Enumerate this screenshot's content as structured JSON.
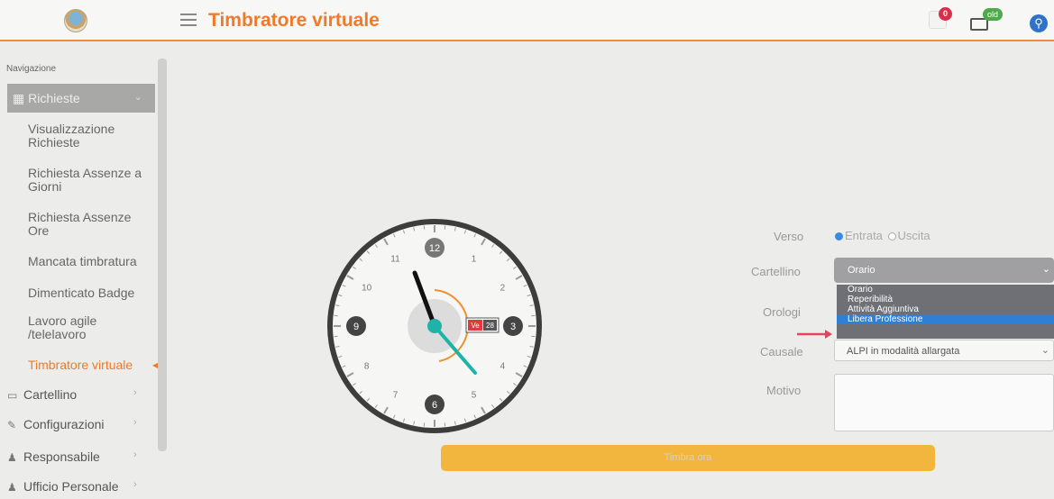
{
  "header": {
    "title": "Timbratore virtuale",
    "notifications_count": "0",
    "mail_badge": "old",
    "accessibility_glyph": "⚲",
    "accent_color": "#ef7a2a"
  },
  "sidebar": {
    "nav_title": "Navigazione",
    "active_group": "Richieste",
    "items": [
      {
        "label": "Visualizzazione Richieste"
      },
      {
        "label": "Richiesta Assenze a Giorni"
      },
      {
        "label": "Richiesta Assenze Ore"
      },
      {
        "label": "Mancata timbratura"
      },
      {
        "label": "Dimenticato Badge"
      },
      {
        "label": "Lavoro agile /telelavoro"
      },
      {
        "label": "Timbratore virtuale"
      }
    ],
    "groups": [
      {
        "label": "Cartellino",
        "icon": "calendar-icon"
      },
      {
        "label": "Configurazioni",
        "icon": "wrench-icon"
      },
      {
        "label": "Responsabile",
        "icon": "user-icon"
      },
      {
        "label": "Ufficio Personale",
        "icon": "users-icon"
      }
    ]
  },
  "clock": {
    "numerals": [
      "12",
      "1",
      "2",
      "3",
      "4",
      "5",
      "6",
      "7",
      "8",
      "9",
      "10",
      "11"
    ],
    "date_day": "Ve",
    "date_num": "28"
  },
  "form": {
    "verso_label": "Verso",
    "verso_options": [
      "Entrata",
      "Uscita"
    ],
    "verso_selected": "Entrata",
    "cartellino_label": "Cartellino",
    "cartellino_value": "Orario",
    "cartellino_options": [
      "Orario",
      "Reperibilità",
      "Attività Aggiuntiva",
      "Libera Professione"
    ],
    "cartellino_highlighted": "Libera Professione",
    "orologi_label": "Orologi",
    "causale_label": "Causale",
    "causale_value": "ALPI in modalità allargata",
    "motivo_label": "Motivo",
    "motivo_value": "",
    "submit_label": "Timbra ora"
  }
}
